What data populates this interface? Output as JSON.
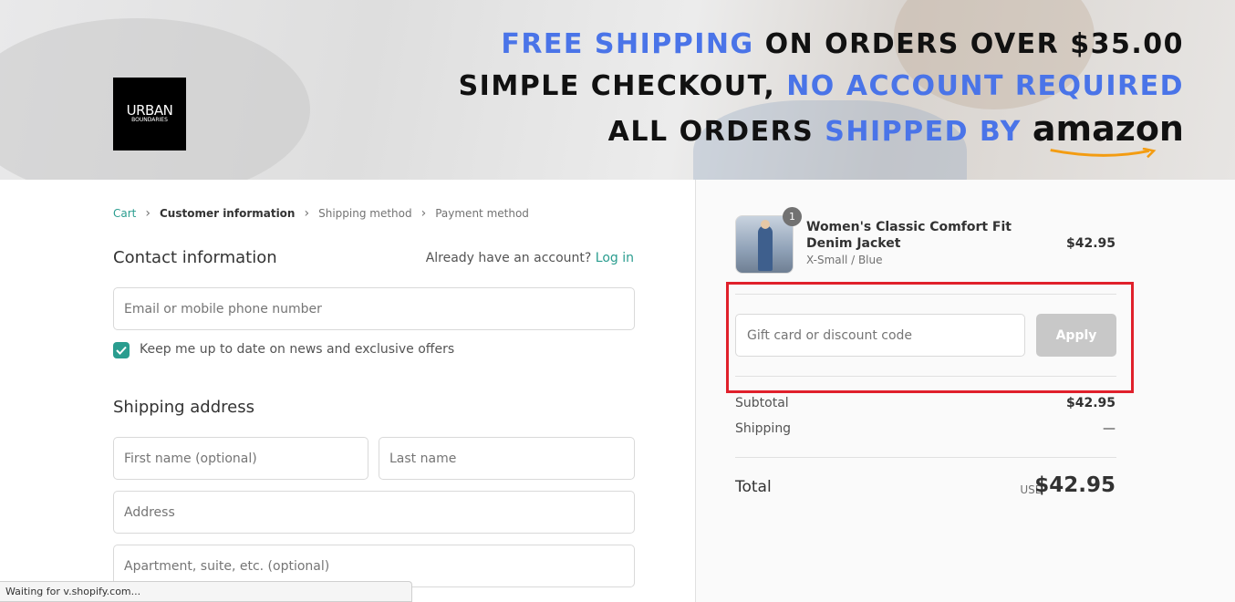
{
  "banner": {
    "logo_line1": "URBAN",
    "logo_line2": "BOUNDARIES",
    "line1_blue": "FREE SHIPPING",
    "line1_black": "ON ORDERS OVER $35.00",
    "line2_black": "SIMPLE CHECKOUT,",
    "line2_blue": "NO ACCOUNT REQUIRED",
    "line3_black": "ALL ORDERS",
    "line3_blue": "SHIPPED BY",
    "line3_brand": "amazon"
  },
  "breadcrumb": {
    "items": [
      "Cart",
      "Customer information",
      "Shipping method",
      "Payment method"
    ]
  },
  "contact": {
    "title": "Contact information",
    "account_question": "Already have an account?",
    "login_link": "Log in",
    "email_placeholder": "Email or mobile phone number",
    "newsletter_label": "Keep me up to date on news and exclusive offers",
    "newsletter_checked": true
  },
  "shipping": {
    "title": "Shipping address",
    "first_name_placeholder": "First name (optional)",
    "last_name_placeholder": "Last name",
    "address_placeholder": "Address",
    "apartment_placeholder": "Apartment, suite, etc. (optional)"
  },
  "order": {
    "quantity": "1",
    "product_name": "Women's Classic Comfort Fit Denim Jacket",
    "variant": "X-Small / Blue",
    "price": "$42.95",
    "discount_placeholder": "Gift card or discount code",
    "apply_label": "Apply",
    "subtotal_label": "Subtotal",
    "subtotal_value": "$42.95",
    "shipping_label": "Shipping",
    "shipping_value": "—",
    "total_label": "Total",
    "currency": "USD",
    "total_value": "$42.95"
  },
  "status_bar": "Waiting for v.shopify.com...",
  "colors": {
    "accent": "#2a9d8f",
    "banner_blue": "#4a74e8",
    "highlight": "#e0202b"
  }
}
